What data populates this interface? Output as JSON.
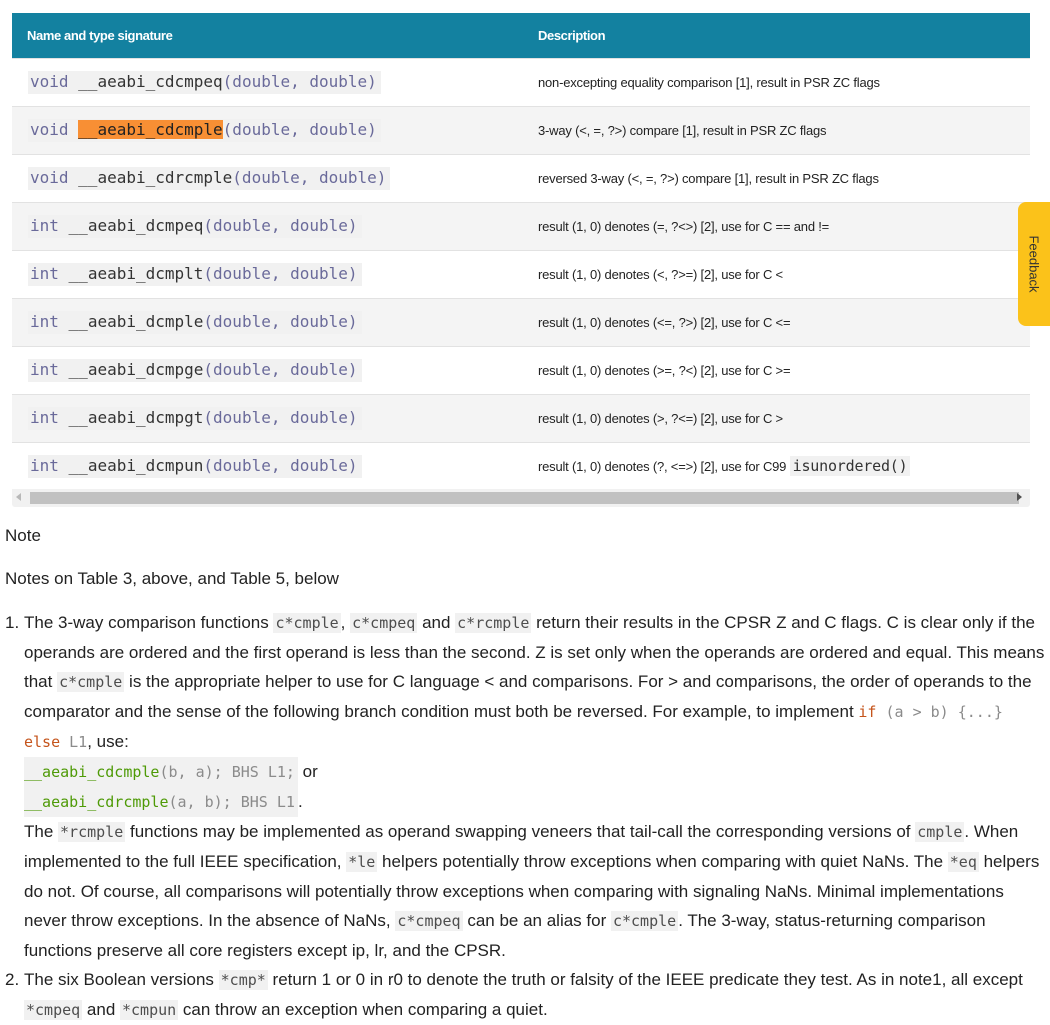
{
  "table": {
    "headers": [
      "Name and type signature",
      "Description"
    ],
    "rows": [
      {
        "ret": "void",
        "fn": "__aeabi_cdcmpeq",
        "args": "(double, double)",
        "desc": "non-excepting equality comparison [1], result in PSR ZC flags"
      },
      {
        "ret": "void",
        "fn": "__aeabi_cdcmple",
        "args": "(double, double)",
        "desc": "3-way (<, =, ?>) compare [1], result in PSR ZC flags"
      },
      {
        "ret": "void",
        "fn": "__aeabi_cdrcmple",
        "args": "(double, double)",
        "desc": "reversed 3-way (<, =, ?>) compare [1], result in PSR ZC flags"
      },
      {
        "ret": "int",
        "fn": "__aeabi_dcmpeq",
        "args": "(double, double)",
        "desc": "result (1, 0) denotes (=, ?<>) [2], use for C == and !="
      },
      {
        "ret": "int",
        "fn": "__aeabi_dcmplt",
        "args": "(double, double)",
        "desc": "result (1, 0) denotes (<, ?>=) [2], use for C <"
      },
      {
        "ret": "int",
        "fn": "__aeabi_dcmple",
        "args": "(double, double)",
        "desc": "result (1, 0) denotes (<=, ?>) [2], use for C <="
      },
      {
        "ret": "int",
        "fn": "__aeabi_dcmpge",
        "args": "(double, double)",
        "desc": "result (1, 0) denotes (>=, ?<) [2], use for C >="
      },
      {
        "ret": "int",
        "fn": "__aeabi_dcmpgt",
        "args": "(double, double)",
        "desc": "result (1, 0) denotes (>, ?<=) [2], use for C >"
      },
      {
        "ret": "int",
        "fn": "__aeabi_dcmpun",
        "args": "(double, double)",
        "desc": "result (1, 0) denotes (?, <=>) [2], use for C99",
        "desc_code": "isunordered()"
      }
    ],
    "highlight": {
      "fn_prefix": "__",
      "fn_highlight": "aeabi_cdcmple"
    }
  },
  "feedback": {
    "label": "Feedback"
  },
  "scrollbar": {
    "icon_left": "scroll-left-icon",
    "icon_right": "scroll-right-icon"
  },
  "note": {
    "title": "Note",
    "subtitle": "Notes on Table 3, above, and Table 5, below",
    "n1": {
      "num": "1.",
      "t1": "The 3-way comparison functions ",
      "c1": "c*cmple",
      "t2": ", ",
      "c2": "c*cmpeq",
      "t3": " and ",
      "c3": "c*rcmple",
      "t4": " return their results in the CPSR Z and C flags. C is clear only if the operands are ordered and the first operand is less than the second. Z is set only when the operands are ordered and equal. This means that ",
      "c4": "c*cmple",
      "t5": " is the appropriate helper to use for C language < and comparisons. For > and comparisons, the order of operands to the comparator and the sense of the following branch condition must both be reversed. For example, to implement ",
      "k_if": "if",
      "k_cond": " (a > b) {...} ",
      "k_else": "else",
      "k_l1": " L1",
      "t6": ", use:",
      "l1_fn": "__aeabi_cdcmple",
      "l1_rest": "(b, a); BHS L1;",
      "l1_tail": " or",
      "l2_fn": "__aeabi_cdrcmple",
      "l2_rest": "(a, b); BHS L1",
      "l2_tail": ".",
      "p2_t1": "The ",
      "p2_c1": "*rcmple",
      "p2_t2": " functions may be implemented as operand swapping veneers that tail-call the corresponding versions of ",
      "p2_c2": "cmple",
      "p2_t3": ". When implemented to the full IEEE specification, ",
      "p2_c3": "*le",
      "p2_t4": " helpers potentially throw exceptions when comparing with quiet NaNs. The ",
      "p2_c4": "*eq",
      "p2_t5": " helpers do not. Of course, all comparisons will potentially throw exceptions when comparing with signaling NaNs. Minimal implementations never throw exceptions. In the absence of NaNs, ",
      "p2_c5": "c*cmpeq",
      "p2_t6": " can be an alias for ",
      "p2_c6": "c*cmple",
      "p2_t7": ". The 3-way, status-returning comparison functions preserve all core registers except ip, lr, and the CPSR."
    },
    "n2": {
      "num": "2.",
      "t1": "The six Boolean versions ",
      "c1": "*cmp*",
      "t2": " return 1 or 0 in r0 to denote the truth or falsity of the IEEE predicate they test. As in note1, all except ",
      "c2": "*cmpeq",
      "t3": " and ",
      "c3": "*cmpun",
      "t4": " can throw an exception when comparing a quiet."
    }
  }
}
